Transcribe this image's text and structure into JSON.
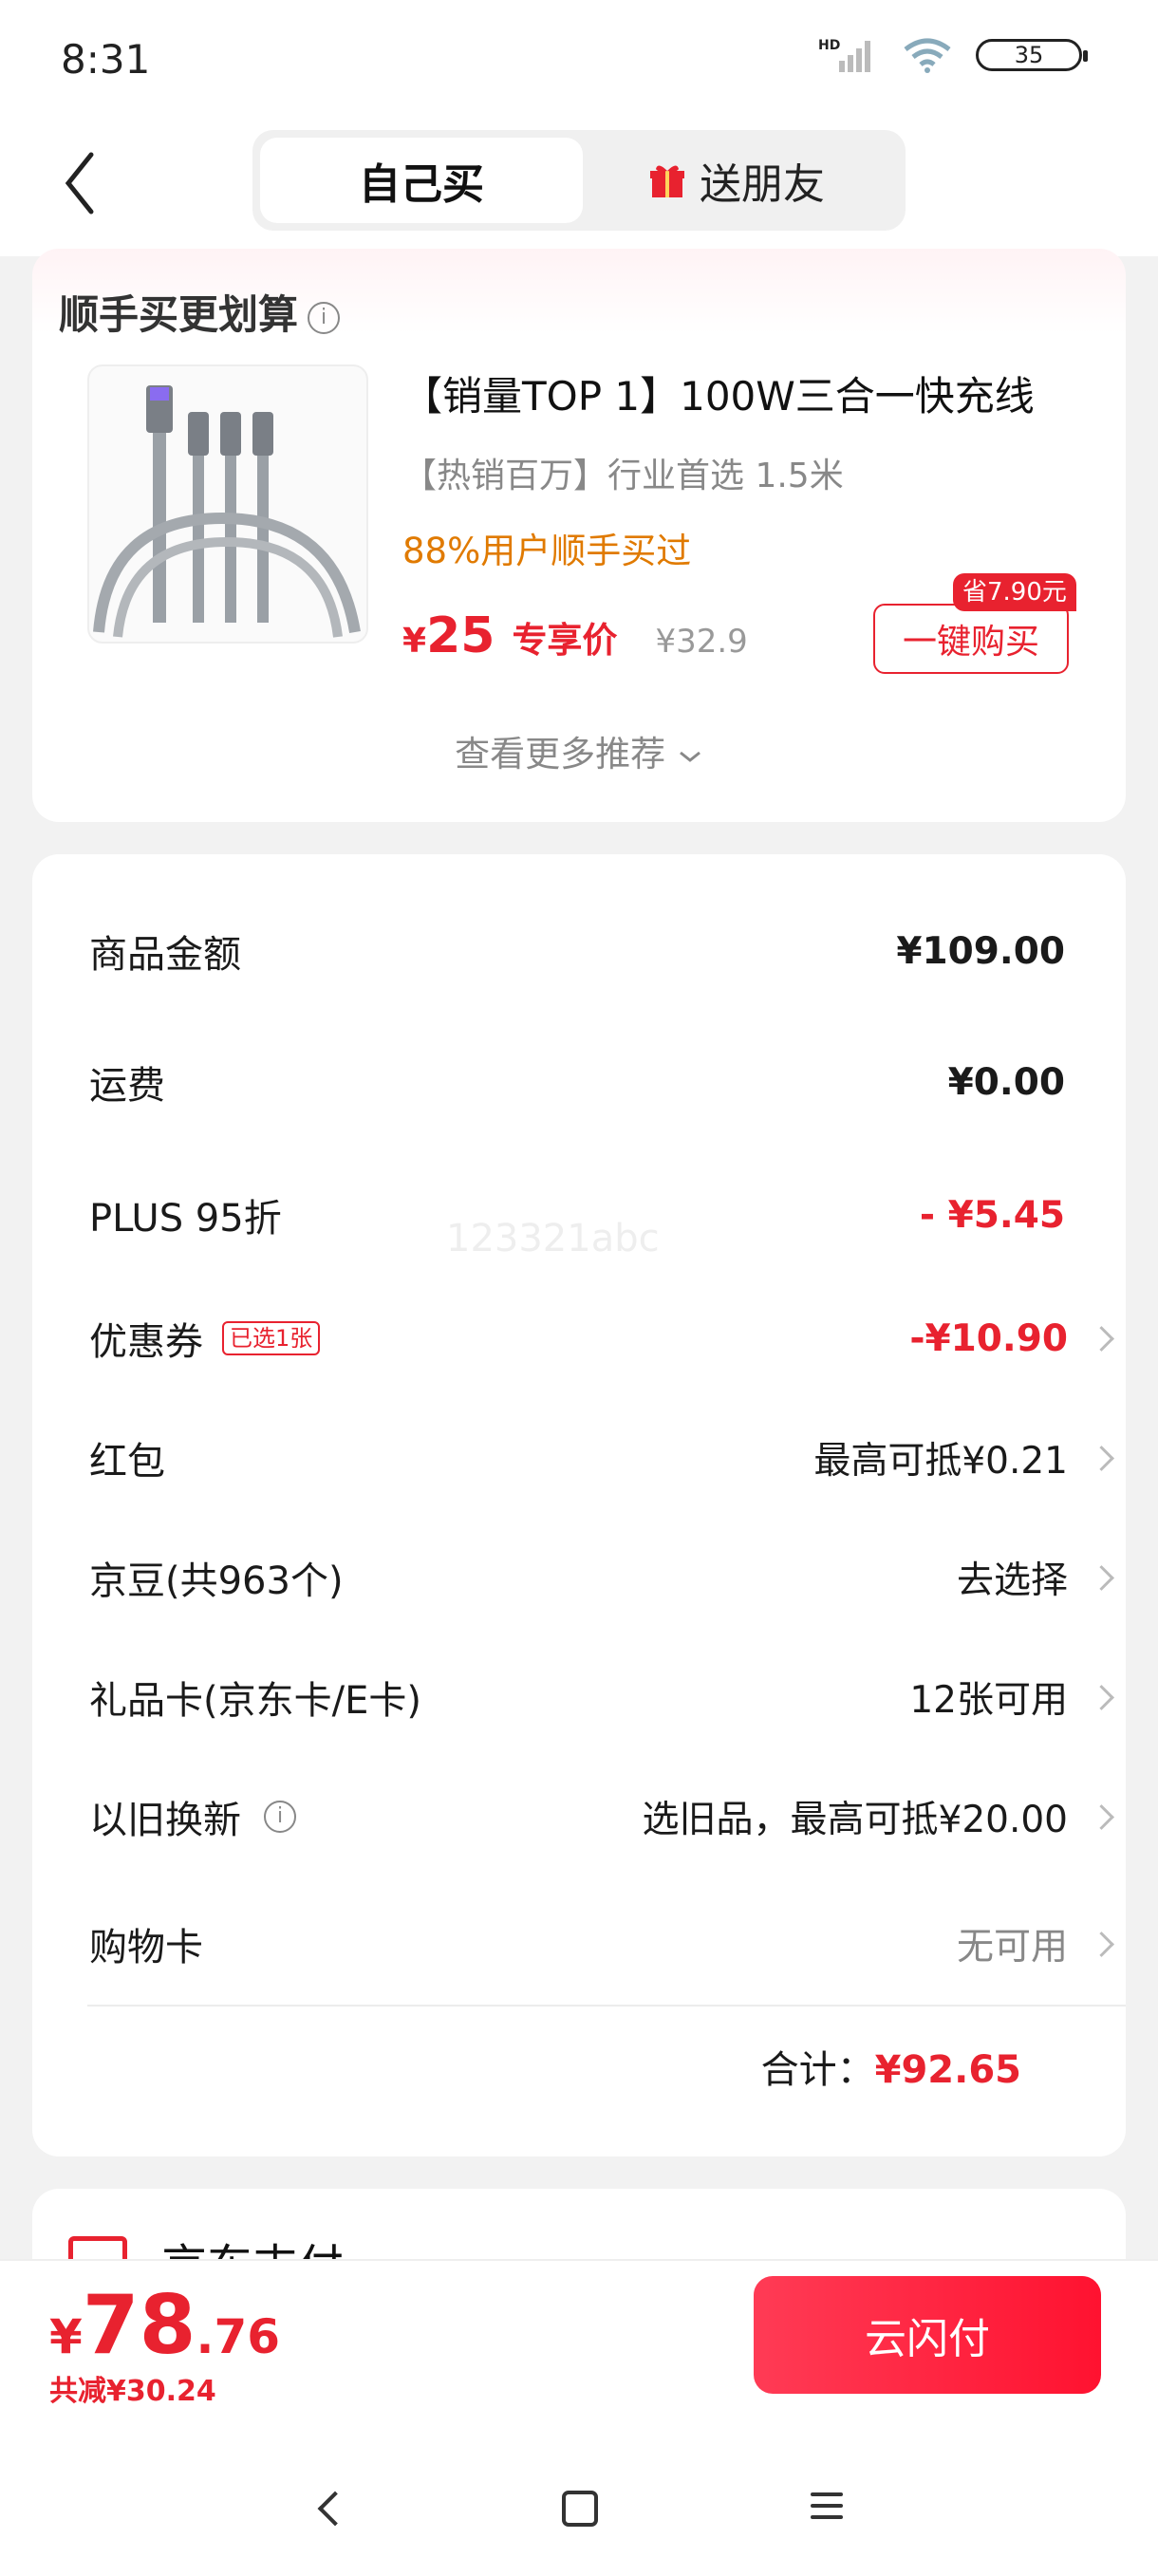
{
  "status": {
    "time": "8:31",
    "network": "HD",
    "battery": "35"
  },
  "nav": {
    "tab_self": "自己买",
    "tab_gift": "送朋友",
    "gift_icon": "gift-icon"
  },
  "recommend": {
    "title": "顺手买更划算",
    "product_name": "【销量TOP 1】100W三合一快充线",
    "product_sub": "【热销百万】行业首选 1.5米",
    "social_proof": "88%用户顺手买过",
    "currency": "¥",
    "price": "25",
    "price_tag": "专享价",
    "original_price": "¥32.9",
    "save_badge": "省7.90元",
    "buy_button": "一键购买",
    "see_more": "查看更多推荐"
  },
  "summary": {
    "watermark": "123321abc",
    "rows": [
      {
        "label": "商品金额",
        "value": "¥109.00"
      },
      {
        "label": "运费",
        "value": "¥0.00"
      },
      {
        "label": "PLUS 95折",
        "value": "- ¥5.45"
      },
      {
        "label": "优惠券",
        "badge": "已选1张",
        "value": "-¥10.90"
      },
      {
        "label": "红包",
        "value": "最高可抵¥0.21"
      },
      {
        "label": "京豆(共963个)",
        "value": "去选择"
      },
      {
        "label": "礼品卡(京东卡/E卡)",
        "value": "12张可用"
      },
      {
        "label": "以旧换新",
        "value": "选旧品，最高可抵¥20.00"
      },
      {
        "label": "购物卡",
        "value": "无可用"
      }
    ],
    "total_label": "合计：",
    "total_value": "¥92.65"
  },
  "next_section": {
    "title": "京东支付"
  },
  "bottom": {
    "currency": "¥",
    "price_int": "78",
    "price_dec": ".76",
    "saved": "共减¥30.24",
    "pay_button": "云闪付"
  },
  "colors": {
    "accent": "#e8222f",
    "social": "#e07a00"
  }
}
